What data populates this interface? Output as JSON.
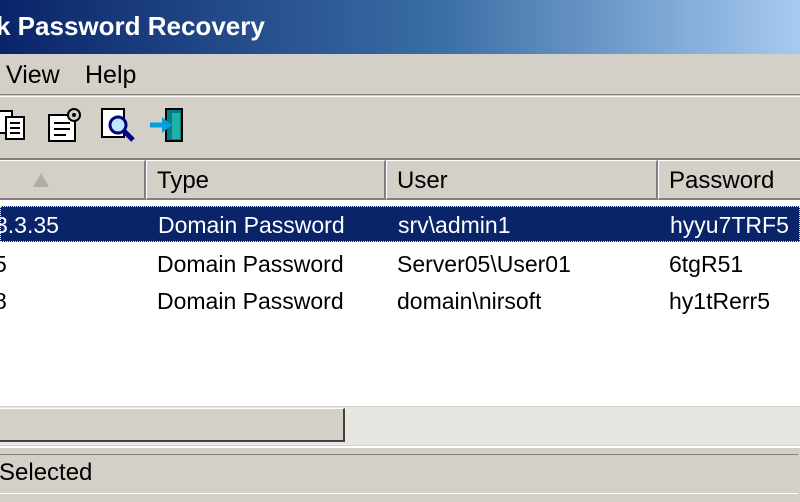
{
  "window": {
    "title": "k Password Recovery"
  },
  "menu": [
    {
      "label": "View"
    },
    {
      "label": "Help"
    }
  ],
  "toolbar": [
    {
      "icon": "copy-icon"
    },
    {
      "icon": "properties-icon"
    },
    {
      "icon": "find-icon"
    },
    {
      "icon": "exit-icon"
    }
  ],
  "columns": [
    {
      "label": ""
    },
    {
      "label": "Type"
    },
    {
      "label": "User"
    },
    {
      "label": "Password"
    }
  ],
  "rows": [
    {
      "item": "3.3.35",
      "type": "Domain Password",
      "user": "srv\\admin1",
      "password": "hyyu7TRF5",
      "selected": true
    },
    {
      "item": "5",
      "type": "Domain Password",
      "user": "Server05\\User01",
      "password": "6tgR51",
      "selected": false
    },
    {
      "item": "8",
      "type": "Domain Password",
      "user": "domain\\nirsoft",
      "password": "hy1tRerr5",
      "selected": false
    }
  ],
  "status": {
    "text": "Selected"
  },
  "colors": {
    "title_start": "#0a246a",
    "title_end": "#a6caf0",
    "selection": "#0a246a",
    "face": "#d4d0c8"
  }
}
